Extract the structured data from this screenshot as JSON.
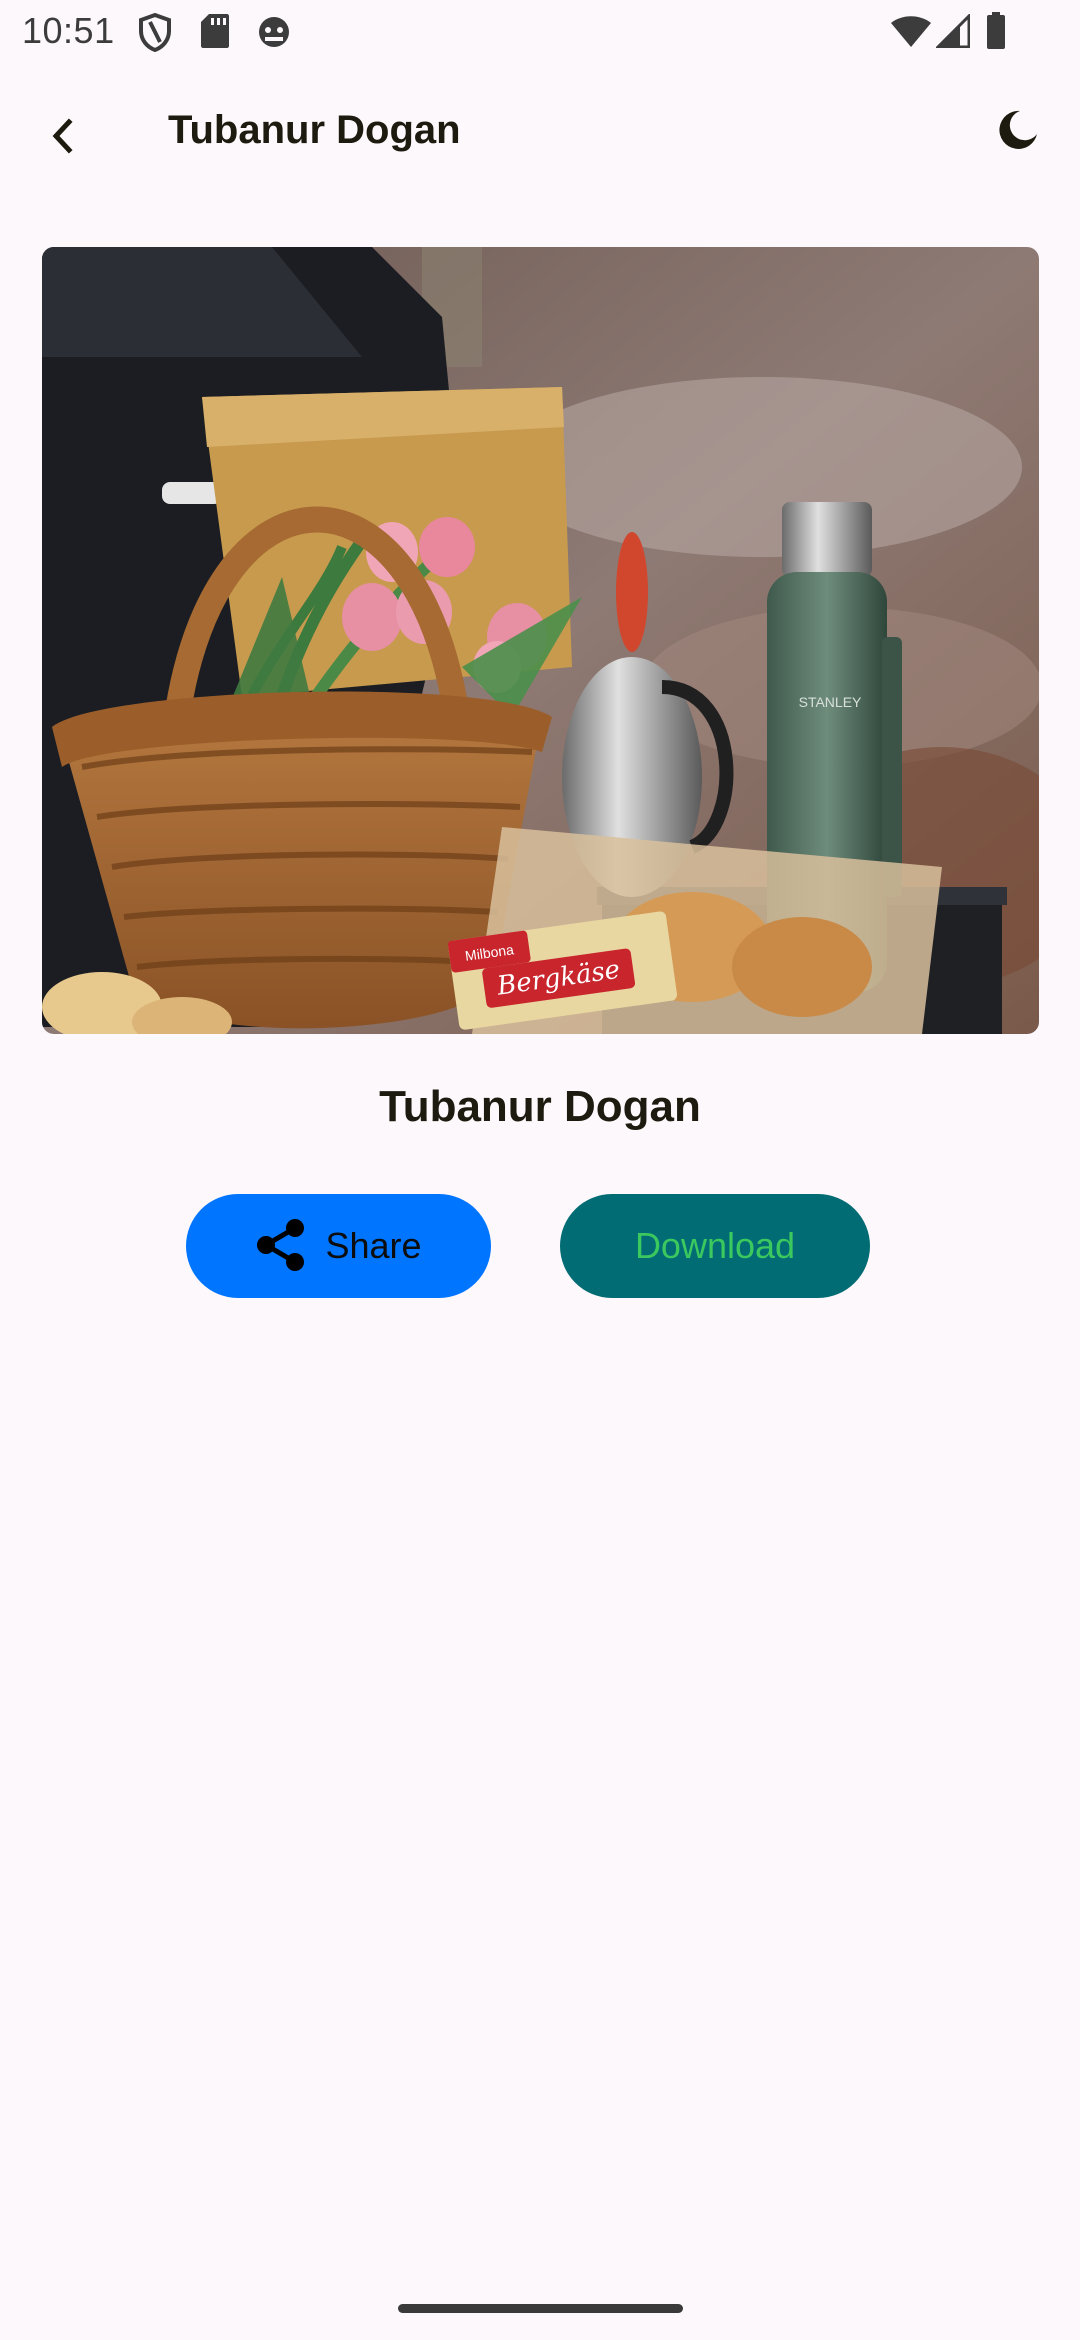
{
  "status_bar": {
    "time": "10:51",
    "left_icons": [
      "shield-icon",
      "sd-card-icon",
      "android-debug-icon"
    ],
    "right_icons": [
      "wifi-icon",
      "signal-icon",
      "battery-icon"
    ]
  },
  "app_bar": {
    "back_icon": "chevron-left-icon",
    "title": "Tubanur Dogan",
    "theme_icon": "moon-icon"
  },
  "photo": {
    "description_icon": "photo",
    "brand_texts": [
      "STANLEY",
      "Milbona",
      "Bergkäse"
    ]
  },
  "author": {
    "name": "Tubanur Dogan"
  },
  "actions": {
    "share_label": "Share",
    "share_icon": "share-icon",
    "download_label": "Download"
  },
  "colors": {
    "background": "#fdf8fb",
    "share_button": "#0075ff",
    "download_button": "#016c74",
    "download_text": "#3bc85e",
    "title_text": "#1d1b10"
  }
}
